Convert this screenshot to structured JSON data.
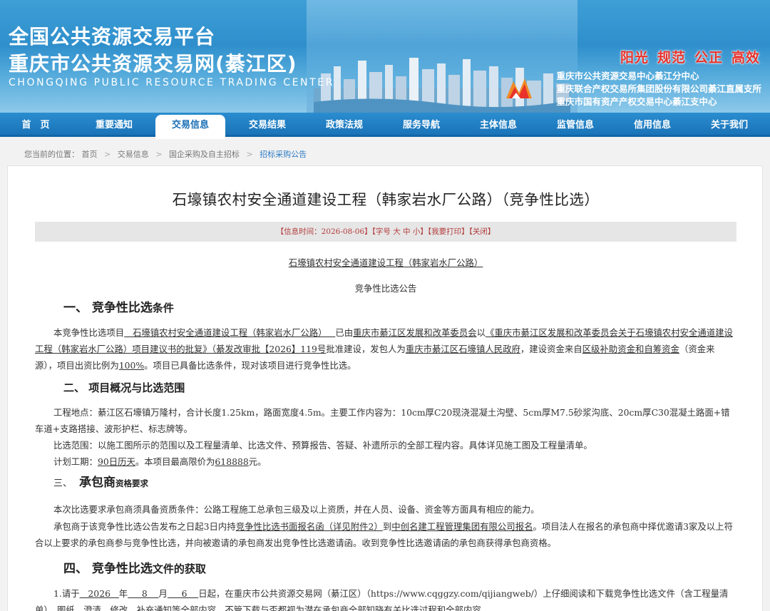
{
  "banner": {
    "title_line1": "全国公共资源交易平台",
    "title_line2": "重庆市公共资源交易网(綦江区)",
    "title_en": "CHONGQING PUBLIC RESOURCE TRADING CENTER",
    "slogans": [
      "阳光",
      "规范",
      "公正",
      "高效"
    ],
    "centers": [
      "重庆市公共资源交易中心綦江分中心",
      "重庆联合产权交易所集团股份有限公司綦江直属支所",
      "重庆市国有资产产权交易中心綦江支中心"
    ]
  },
  "nav": [
    "首　页",
    "重要通知",
    "交易信息",
    "交易结果",
    "政策法规",
    "服务导航",
    "主体信息",
    "监管信息",
    "信用信息",
    "关于我们"
  ],
  "breadcrumb": {
    "prefix": "您当前的位置：",
    "items": [
      "首页",
      "交易信息",
      "国企采购及自主招标",
      "招标采购公告"
    ]
  },
  "article": {
    "title": "石壕镇农村安全通道建设工程（韩家岩水厂公路）（竞争性比选）",
    "info": "【信息时间：2026-08-06】【字号 大 中 小】【我要打印】【关闭】",
    "subtitle": "石壕镇农村安全通道建设工程（韩家岩水厂公路）",
    "announce": "竞争性比选公告",
    "s1_head_a": "一、  竞争性比选",
    "s1_head_b": "条件",
    "s1_p1_a": "本竞争性比选项目",
    "s1_p1_b": "   石壕镇农村安全通道建设工程（韩家岩水厂公路）   ",
    "s1_p1_c": "已由",
    "s1_p1_d": "重庆市綦江区发展和改革委员会",
    "s1_p1_e": "以",
    "s1_p1_f": "《重庆市綦江区发展和改革委员会关于石壕镇农村安全通道建设工程（韩家岩水厂公路）项目建议书的批复》（綦发改审批【2026】119号",
    "s1_p1_g": "批准建设，发包人为",
    "s1_p1_h": "重庆市綦江区石壕镇人民政府",
    "s1_p1_i": "，建设资金来自",
    "s1_p1_j": "区级补助资金和自筹资金",
    "s1_p1_k": "（资金来源），项目出资比例为",
    "s1_p1_l": "100%",
    "s1_p1_m": "。项目已具备比选条件，现对该项目进行竞争性比选。",
    "s2_head": "二、  项目概况与比选范围",
    "s2_p1": "工程地点：綦江区石壕镇万隆村，合计长度1.25km，路面宽度4.5m。主要工作内容为：10cm厚C20现浇混凝土沟壁、5cm厚M7.5砂浆沟底、20cm厚C30混凝土路面+错车道+支路搭接、波形护栏、标志牌等。",
    "s2_p2": "比选范围：以施工图所示的范围以及工程量清单、比选文件、预算报告、答疑、补遗所示的全部工程内容。具体详见施工图及工程量清单。",
    "s2_p3_a": "计划工期：",
    "s2_p3_b": "90日历天",
    "s2_p3_c": "。本项目最高限价为",
    "s2_p3_d": "618888",
    "s2_p3_e": "元。",
    "s3_head_a": "三、",
    "s3_head_b": "承包商",
    "s3_head_c": "资格要求",
    "s3_p1": "本次比选要求承包商须具备资质条件：公路工程施工总承包三级及以上资质，并在人员、设备、资金等方面具有相应的能力。",
    "s3_p2_a": "承包商于该竞争性比选公告发布之日起3日内持",
    "s3_p2_b": "竞争性比选书面报名函（详见附件2）",
    "s3_p2_c": "到",
    "s3_p2_d": "中创名建工程管理集团有限公司报名",
    "s3_p2_e": "。项目法人在报名的承包商中择优邀请3家及以上符合以上要求的承包商参与竞争性比选，并向被邀请的承包商发出竞争性比选邀请函。收到竞争性比选邀请函的承包商获得承包商资格。",
    "s4_head_a": "四、  竞争性比选",
    "s4_head_b": "文件的获取",
    "s4_p1_a": "1.请于",
    "s4_p1_b": "   2026   ",
    "s4_p1_c": "年",
    "s4_p1_d": "     8    ",
    "s4_p1_e": "月",
    "s4_p1_f": "     6    ",
    "s4_p1_g": "日起，在重庆市公共资源交易网（綦江区）（https://www.cqggzy.com/qijiangweb/）上仔细阅读和下载竞争性比选文件（含工程量清单）、图纸、澄清、修改、补充通知等全部内容。不管下载与否都视为潜在承包商全部知晓有关比选过程和全部内容。"
  }
}
